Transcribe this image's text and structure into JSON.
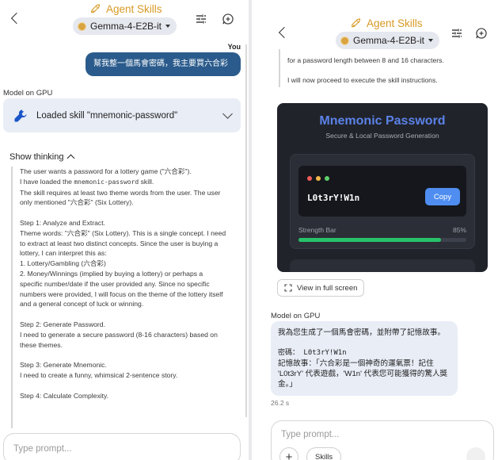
{
  "app": {
    "title": "Agent Skills",
    "model": "Gemma-4-E2B-it"
  },
  "left": {
    "you_label": "You",
    "user_message": "幫我整一個馬會密碼，我主要買六合彩",
    "model_label": "Model on GPU",
    "skill_loaded": "Loaded skill \"mnemonic-password\"",
    "show_thinking": "Show thinking",
    "thinking": [
      "The user wants a password for a lottery game (\"六合彩\").",
      "I have loaded the ",
      "mnemonic-password",
      " skill.",
      "The skill requires at least two theme words from the user. The user only mentioned \"六合彩\" (Six Lottery).",
      "Step 1: Analyze and Extract.\nTheme words: \"六合彩\" (Six Lottery). This is a single concept. I need to extract at least two distinct concepts. Since the user is buying a lottery, I can interpret this as:\n1. Lottery/Gambling (六合彩)\n2. Money/Winnings (implied by buying a lottery) or perhaps a specific number/date if the user provided any. Since no specific numbers were provided, I will focus on the theme of the lottery itself and a general concept of luck or winning.",
      "Step 2: Generate Password.\nI need to generate a secure password (8-16 characters) based on these themes.",
      "Step 3: Generate Mnemonic.\nI need to create a funny, whimsical 2-sentence story.",
      "Step 4: Calculate Complexity."
    ],
    "input_placeholder": "Type prompt..."
  },
  "right": {
    "thinking_partial_1": "for a password length between 8 and 16 characters.",
    "thinking_partial_2": "I will now proceed to execute the skill instructions.",
    "card": {
      "title": "Mnemonic Password",
      "subtitle": "Secure & Local Password Generation",
      "password": "L0t3rY!W1n",
      "copy_label": "Copy",
      "strength_label": "Strength Bar",
      "strength_pct_text": "85%",
      "strength": 0.85
    },
    "fullscreen_label": "View in full screen",
    "model_label": "Model on GPU",
    "response_intro": "我為您生成了一個馬會密碼，並附帶了記憶故事。",
    "password_line": "密碼： L0t3rY!W1n",
    "story": "記憶故事：「六合彩是一個神奇的運氣票！記住 'L0t3rY' 代表遊戲，'W1n' 代表您可能獲得的驚人獎金。」",
    "time": "26.2 s",
    "input_placeholder": "Type prompt...",
    "plus_label": "+",
    "skills_label": "Skills"
  },
  "colors": {
    "accent_gold": "#d89a25",
    "user_bubble": "#2a5b8c",
    "card_bg": "#20232a",
    "card_title": "#5b82e8",
    "copy_button": "#4f8ef0",
    "strength_fill": "#27c26a"
  },
  "icons": [
    "back-chevron-icon",
    "sparkle-rocket-icon",
    "model-dot-icon",
    "tune-icon",
    "new-chat-icon",
    "wrench-icon",
    "expand-chevron-icon",
    "collapse-chevron-icon",
    "fullscreen-icon"
  ]
}
